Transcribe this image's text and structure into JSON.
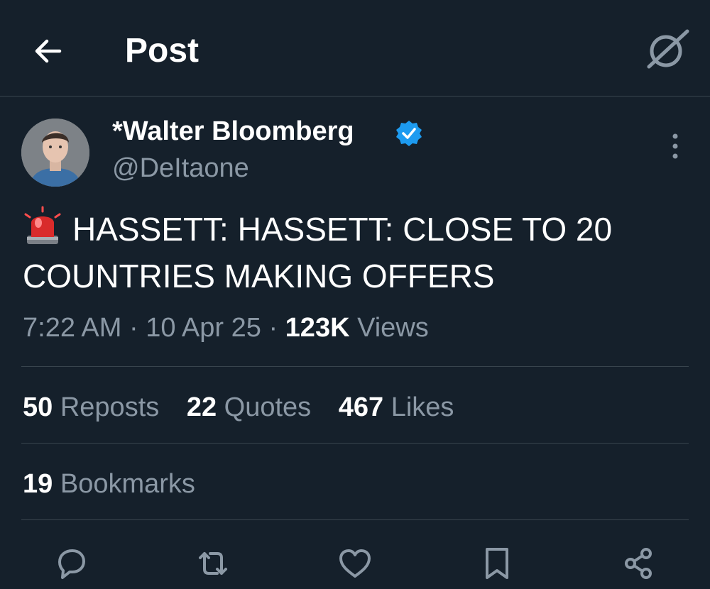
{
  "header": {
    "title": "Post"
  },
  "author": {
    "name": "*Walter Bloomberg",
    "handle": "@DeItaone",
    "verified": true
  },
  "tweet": {
    "emoji": "🚨",
    "text": "HASSETT: HASSETT: CLOSE TO 20 COUNTRIES MAKING OFFERS"
  },
  "meta": {
    "time": "7:22 AM",
    "date": "10 Apr 25",
    "views_count": "123K",
    "views_label": "Views",
    "separator": "·"
  },
  "stats": {
    "reposts_count": "50",
    "reposts_label": "Reposts",
    "quotes_count": "22",
    "quotes_label": "Quotes",
    "likes_count": "467",
    "likes_label": "Likes",
    "bookmarks_count": "19",
    "bookmarks_label": "Bookmarks"
  },
  "actions": [
    "reply-icon",
    "repost-icon",
    "like-icon",
    "bookmark-icon",
    "share-icon"
  ],
  "colors": {
    "background": "#15202b",
    "text": "#ffffff",
    "muted": "#8b98a5",
    "divider": "#38444d",
    "verified": "#1d9bf0"
  }
}
